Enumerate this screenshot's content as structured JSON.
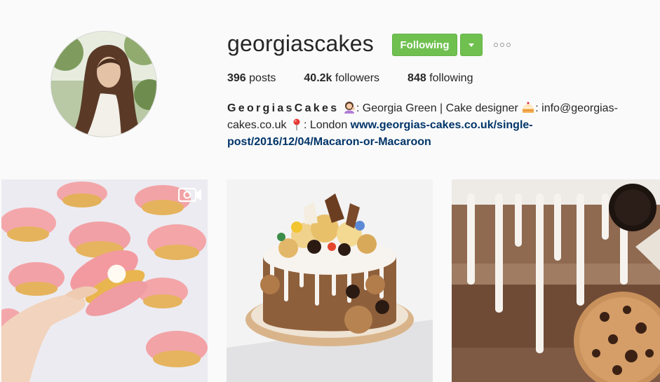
{
  "profile": {
    "username": "georgiascakes",
    "follow_label": "Following",
    "stats": {
      "posts_count": "396",
      "posts_label": "posts",
      "followers_count": "40.2k",
      "followers_label": "followers",
      "following_count": "848",
      "following_label": "following"
    },
    "bio": {
      "name": "GeorgiasCakes",
      "part1": ": Georgia Green | Cake designer ",
      "part2": ": info@georgias-cakes.co.uk ",
      "part3": ": London ",
      "link": "www.georgias-cakes.co.uk/single-post/2016/12/04/Macaron-or-Macaroon"
    }
  },
  "icons": {
    "avatar": "profile-photo",
    "dropdown": "chevron-down-icon",
    "more": "more-options-icon",
    "emoji1": "woman-tipping-hand-emoji",
    "emoji2": "cake-emoji",
    "emoji3": "round-pushpin-emoji",
    "video": "video-icon"
  },
  "colors": {
    "follow_button": "#70c050",
    "link": "#003569",
    "background": "#fafafa"
  },
  "posts": [
    {
      "type": "video",
      "subject": "pink shell macarons"
    },
    {
      "type": "photo",
      "subject": "chocolate drip cake"
    },
    {
      "type": "photo",
      "subject": "chocolate cake close-up"
    }
  ]
}
